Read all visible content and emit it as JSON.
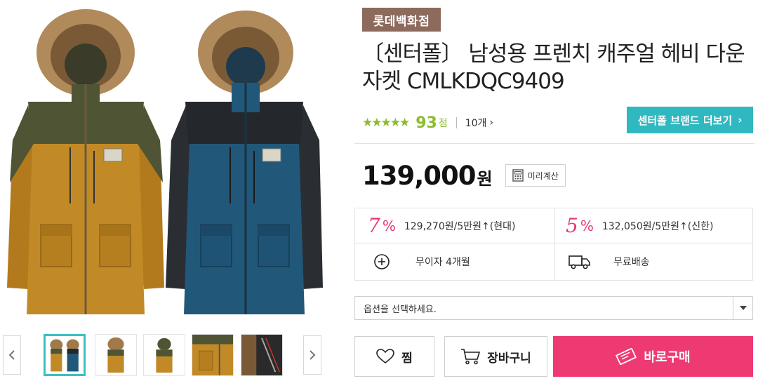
{
  "gallery": {
    "thumbnails": [
      {
        "icon": "two-jackets-thumbnail"
      },
      {
        "icon": "mustard-jacket-thumbnail"
      },
      {
        "icon": "mustard-jacket-back-thumbnail"
      },
      {
        "icon": "pocket-detail-thumbnail"
      },
      {
        "icon": "lining-detail-thumbnail"
      }
    ],
    "active_thumbnail": 0
  },
  "product": {
    "store_badge": "롯데백화점",
    "title": "〔센터폴〕 남성용 프렌치 캐주얼 헤비 다운 자켓 CMLKDQC9409",
    "rating_stars": 4.5,
    "rating_stars_display": "★★★★★",
    "score": "93",
    "score_unit": "점",
    "review_count": "10개",
    "brand_button": "센터폴  브랜드 더보기",
    "price": "139,000",
    "price_unit": "원",
    "calc_button": "미리계산"
  },
  "benefits": {
    "card1": {
      "percent": "7",
      "text": "129,270원/5만원↑(현대)"
    },
    "card2": {
      "percent": "5",
      "text": "132,050원/5만원↑(신한)"
    },
    "installment": "무이자 4개월",
    "shipping": "무료배송",
    "percent_sign": "%"
  },
  "options": {
    "placeholder": "옵션을 선택하세요."
  },
  "actions": {
    "wish": "찜",
    "cart": "장바구니",
    "buy": "바로구매"
  },
  "colors": {
    "accent_pink": "#ee3a73",
    "brand_teal": "#30b8c0",
    "rating_green": "#8dbb2e",
    "badge_brown": "#8c6a5c"
  }
}
